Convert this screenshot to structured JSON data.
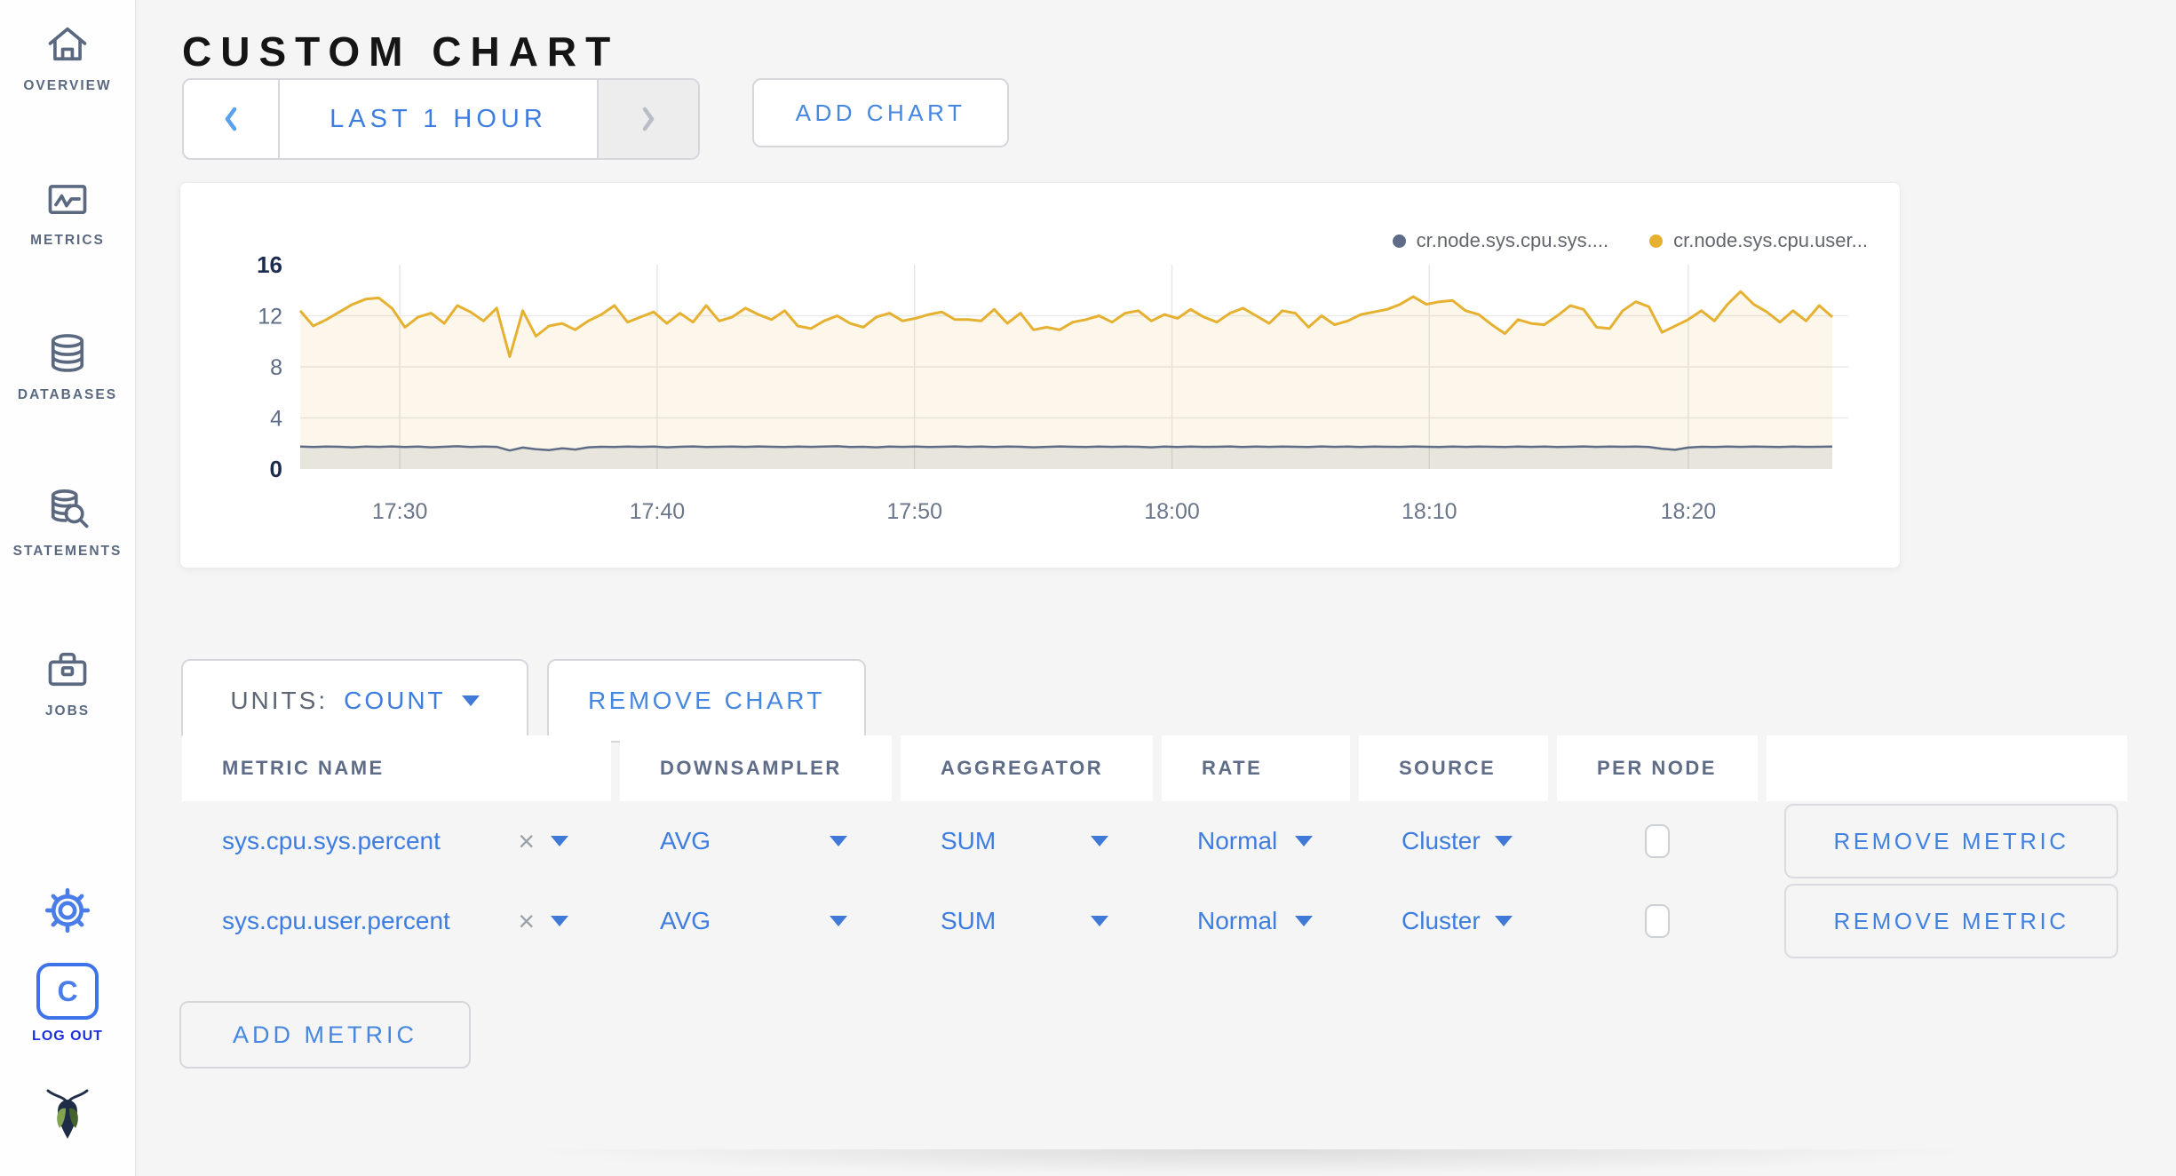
{
  "header": {
    "title": "CUSTOM CHART"
  },
  "sidebar": {
    "items": [
      {
        "label": "OVERVIEW",
        "icon": "home-icon"
      },
      {
        "label": "METRICS",
        "icon": "metrics-chart-icon"
      },
      {
        "label": "DATABASES",
        "icon": "database-icon"
      },
      {
        "label": "STATEMENTS",
        "icon": "statements-search-icon"
      },
      {
        "label": "JOBS",
        "icon": "briefcase-icon"
      }
    ],
    "settings_icon": "gear-icon",
    "logout": {
      "label": "LOG OUT",
      "icon": "cockroach-c-icon"
    },
    "brand_icon": "cockroachdb-bug-logo"
  },
  "toolbar": {
    "prev_icon": "chevron-left-icon",
    "next_icon": "chevron-right-icon",
    "time_range_label": "LAST 1 HOUR",
    "add_chart_label": "ADD CHART"
  },
  "units_bar": {
    "units_label": "UNITS:",
    "units_value": "COUNT",
    "remove_chart_label": "REMOVE CHART"
  },
  "metrics_table": {
    "columns": [
      "METRIC NAME",
      "DOWNSAMPLER",
      "AGGREGATOR",
      "RATE",
      "SOURCE",
      "PER NODE"
    ],
    "remove_x": "×",
    "rows": [
      {
        "metric_name": "sys.cpu.sys.percent",
        "downsampler": "AVG",
        "aggregator": "SUM",
        "rate": "Normal",
        "source": "Cluster",
        "per_node_checked": false,
        "remove_label": "REMOVE METRIC"
      },
      {
        "metric_name": "sys.cpu.user.percent",
        "downsampler": "AVG",
        "aggregator": "SUM",
        "rate": "Normal",
        "source": "Cluster",
        "per_node_checked": false,
        "remove_label": "REMOVE METRIC"
      }
    ],
    "add_metric_label": "ADD METRIC"
  },
  "colors": {
    "accent_blue": "#3e7de0",
    "slate": "#5f6c87",
    "logout_blue": "#1c30e0",
    "series_sys": "#5f6c87",
    "series_user": "#e6b131",
    "page_background": "#f5f5f6"
  },
  "chart_data": {
    "type": "area",
    "title": "",
    "xlabel": "",
    "ylabel": "",
    "ylim": [
      0,
      16
    ],
    "y_ticks": [
      16,
      12,
      8,
      4,
      0
    ],
    "grid_y_values": [
      12,
      8,
      4
    ],
    "legend_position": "top-right",
    "x_ticks": [
      {
        "label": "17:30",
        "frac": 0.065
      },
      {
        "label": "17:40",
        "frac": 0.233
      },
      {
        "label": "17:50",
        "frac": 0.401
      },
      {
        "label": "18:00",
        "frac": 0.569
      },
      {
        "label": "18:10",
        "frac": 0.737
      },
      {
        "label": "18:20",
        "frac": 0.906
      }
    ],
    "series": [
      {
        "name": "cr.node.sys.cpu.sys....",
        "color": "#5f6c87",
        "fill": "rgba(95,108,135,0.13)",
        "width": 2.5,
        "values": [
          1.75,
          1.72,
          1.76,
          1.74,
          1.7,
          1.76,
          1.73,
          1.77,
          1.72,
          1.75,
          1.7,
          1.74,
          1.78,
          1.72,
          1.76,
          1.73,
          1.45,
          1.68,
          1.55,
          1.48,
          1.62,
          1.52,
          1.7,
          1.74,
          1.72,
          1.76,
          1.73,
          1.75,
          1.7,
          1.74,
          1.77,
          1.72,
          1.74,
          1.76,
          1.73,
          1.77,
          1.74,
          1.72,
          1.76,
          1.73,
          1.75,
          1.78,
          1.72,
          1.74,
          1.7,
          1.75,
          1.73,
          1.76,
          1.72,
          1.74,
          1.77,
          1.73,
          1.75,
          1.72,
          1.76,
          1.74,
          1.7,
          1.73,
          1.77,
          1.74,
          1.72,
          1.76,
          1.73,
          1.75,
          1.74,
          1.7,
          1.76,
          1.72,
          1.75,
          1.73,
          1.74,
          1.77,
          1.72,
          1.75,
          1.73,
          1.76,
          1.74,
          1.72,
          1.77,
          1.73,
          1.75,
          1.72,
          1.76,
          1.74,
          1.73,
          1.77,
          1.74,
          1.72,
          1.76,
          1.73,
          1.75,
          1.74,
          1.72,
          1.76,
          1.73,
          1.75,
          1.72,
          1.74,
          1.77,
          1.73,
          1.75,
          1.74,
          1.76,
          1.72,
          1.58,
          1.5,
          1.68,
          1.74,
          1.72,
          1.76,
          1.73,
          1.75,
          1.74,
          1.72,
          1.76,
          1.73,
          1.74,
          1.75
        ]
      },
      {
        "name": "cr.node.sys.cpu.user...",
        "color": "#e6b131",
        "fill": "rgba(230,177,49,0.10)",
        "width": 3,
        "values": [
          12.4,
          11.2,
          11.7,
          12.3,
          12.9,
          13.3,
          13.4,
          12.6,
          11.1,
          11.9,
          12.2,
          11.4,
          12.8,
          12.3,
          11.6,
          12.6,
          8.8,
          12.4,
          10.4,
          11.2,
          11.4,
          10.9,
          11.6,
          12.1,
          12.8,
          11.5,
          11.9,
          12.3,
          11.4,
          12.2,
          11.5,
          12.8,
          11.6,
          11.9,
          12.6,
          12.1,
          11.7,
          12.4,
          11.2,
          11.0,
          11.6,
          12.0,
          11.4,
          11.1,
          11.9,
          12.2,
          11.6,
          11.8,
          12.1,
          12.3,
          11.7,
          11.7,
          11.6,
          12.5,
          11.4,
          12.2,
          10.9,
          11.1,
          10.9,
          11.5,
          11.7,
          12.0,
          11.5,
          12.2,
          12.4,
          11.6,
          12.1,
          11.8,
          12.5,
          11.9,
          11.5,
          12.2,
          12.6,
          12.0,
          11.4,
          12.4,
          12.2,
          11.1,
          12.0,
          11.3,
          11.6,
          12.1,
          12.3,
          12.5,
          12.9,
          13.5,
          12.9,
          13.1,
          13.2,
          12.4,
          12.1,
          11.3,
          10.6,
          11.7,
          11.4,
          11.3,
          12.0,
          12.8,
          12.5,
          11.1,
          11.0,
          12.4,
          13.1,
          12.7,
          10.7,
          11.2,
          11.7,
          12.4,
          11.6,
          12.9,
          13.9,
          12.9,
          12.3,
          11.5,
          12.4,
          11.6,
          12.8,
          11.9
        ]
      }
    ]
  }
}
